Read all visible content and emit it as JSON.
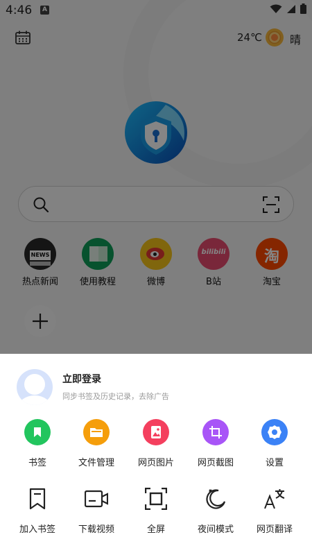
{
  "status": {
    "time": "4:46",
    "notification_icon": "a-letter-icon",
    "icons": [
      "wifi-icon",
      "signal-icon",
      "battery-icon"
    ]
  },
  "weather": {
    "temperature": "24℃",
    "condition": "晴",
    "icon": "sun-icon"
  },
  "search": {
    "placeholder": ""
  },
  "shortcuts": [
    {
      "label": "热点新闻",
      "icon": "news-icon",
      "color": "#1a1a1a",
      "text": "NEWS"
    },
    {
      "label": "使用教程",
      "icon": "tutorial-icon",
      "color": "#0f9d58"
    },
    {
      "label": "微博",
      "icon": "weibo-icon",
      "color": "#f6c31a"
    },
    {
      "label": "B站",
      "icon": "bilibili-icon",
      "color": "#e84b6f",
      "text": "bilibili"
    },
    {
      "label": "淘宝",
      "icon": "taobao-icon",
      "color": "#ff4a00",
      "text": "淘"
    }
  ],
  "sheet": {
    "login_title": "立即登录",
    "login_subtitle": "同步书签及历史记录，去除广告",
    "row1": [
      {
        "label": "书签",
        "icon": "bookmark-icon",
        "color": "#22c55e"
      },
      {
        "label": "文件管理",
        "icon": "folder-icon",
        "color": "#f59e0b"
      },
      {
        "label": "网页图片",
        "icon": "image-icon",
        "color": "#f43f5e"
      },
      {
        "label": "网页截图",
        "icon": "crop-icon",
        "color": "#a855f7"
      },
      {
        "label": "设置",
        "icon": "gear-icon",
        "color": "#3b82f6"
      }
    ],
    "row2": [
      {
        "label": "加入书签",
        "icon": "bookmark-outline-icon"
      },
      {
        "label": "下载视频",
        "icon": "video-icon"
      },
      {
        "label": "全屏",
        "icon": "fullscreen-icon"
      },
      {
        "label": "夜间模式",
        "icon": "moon-icon"
      },
      {
        "label": "网页翻译",
        "icon": "translate-icon"
      }
    ]
  }
}
